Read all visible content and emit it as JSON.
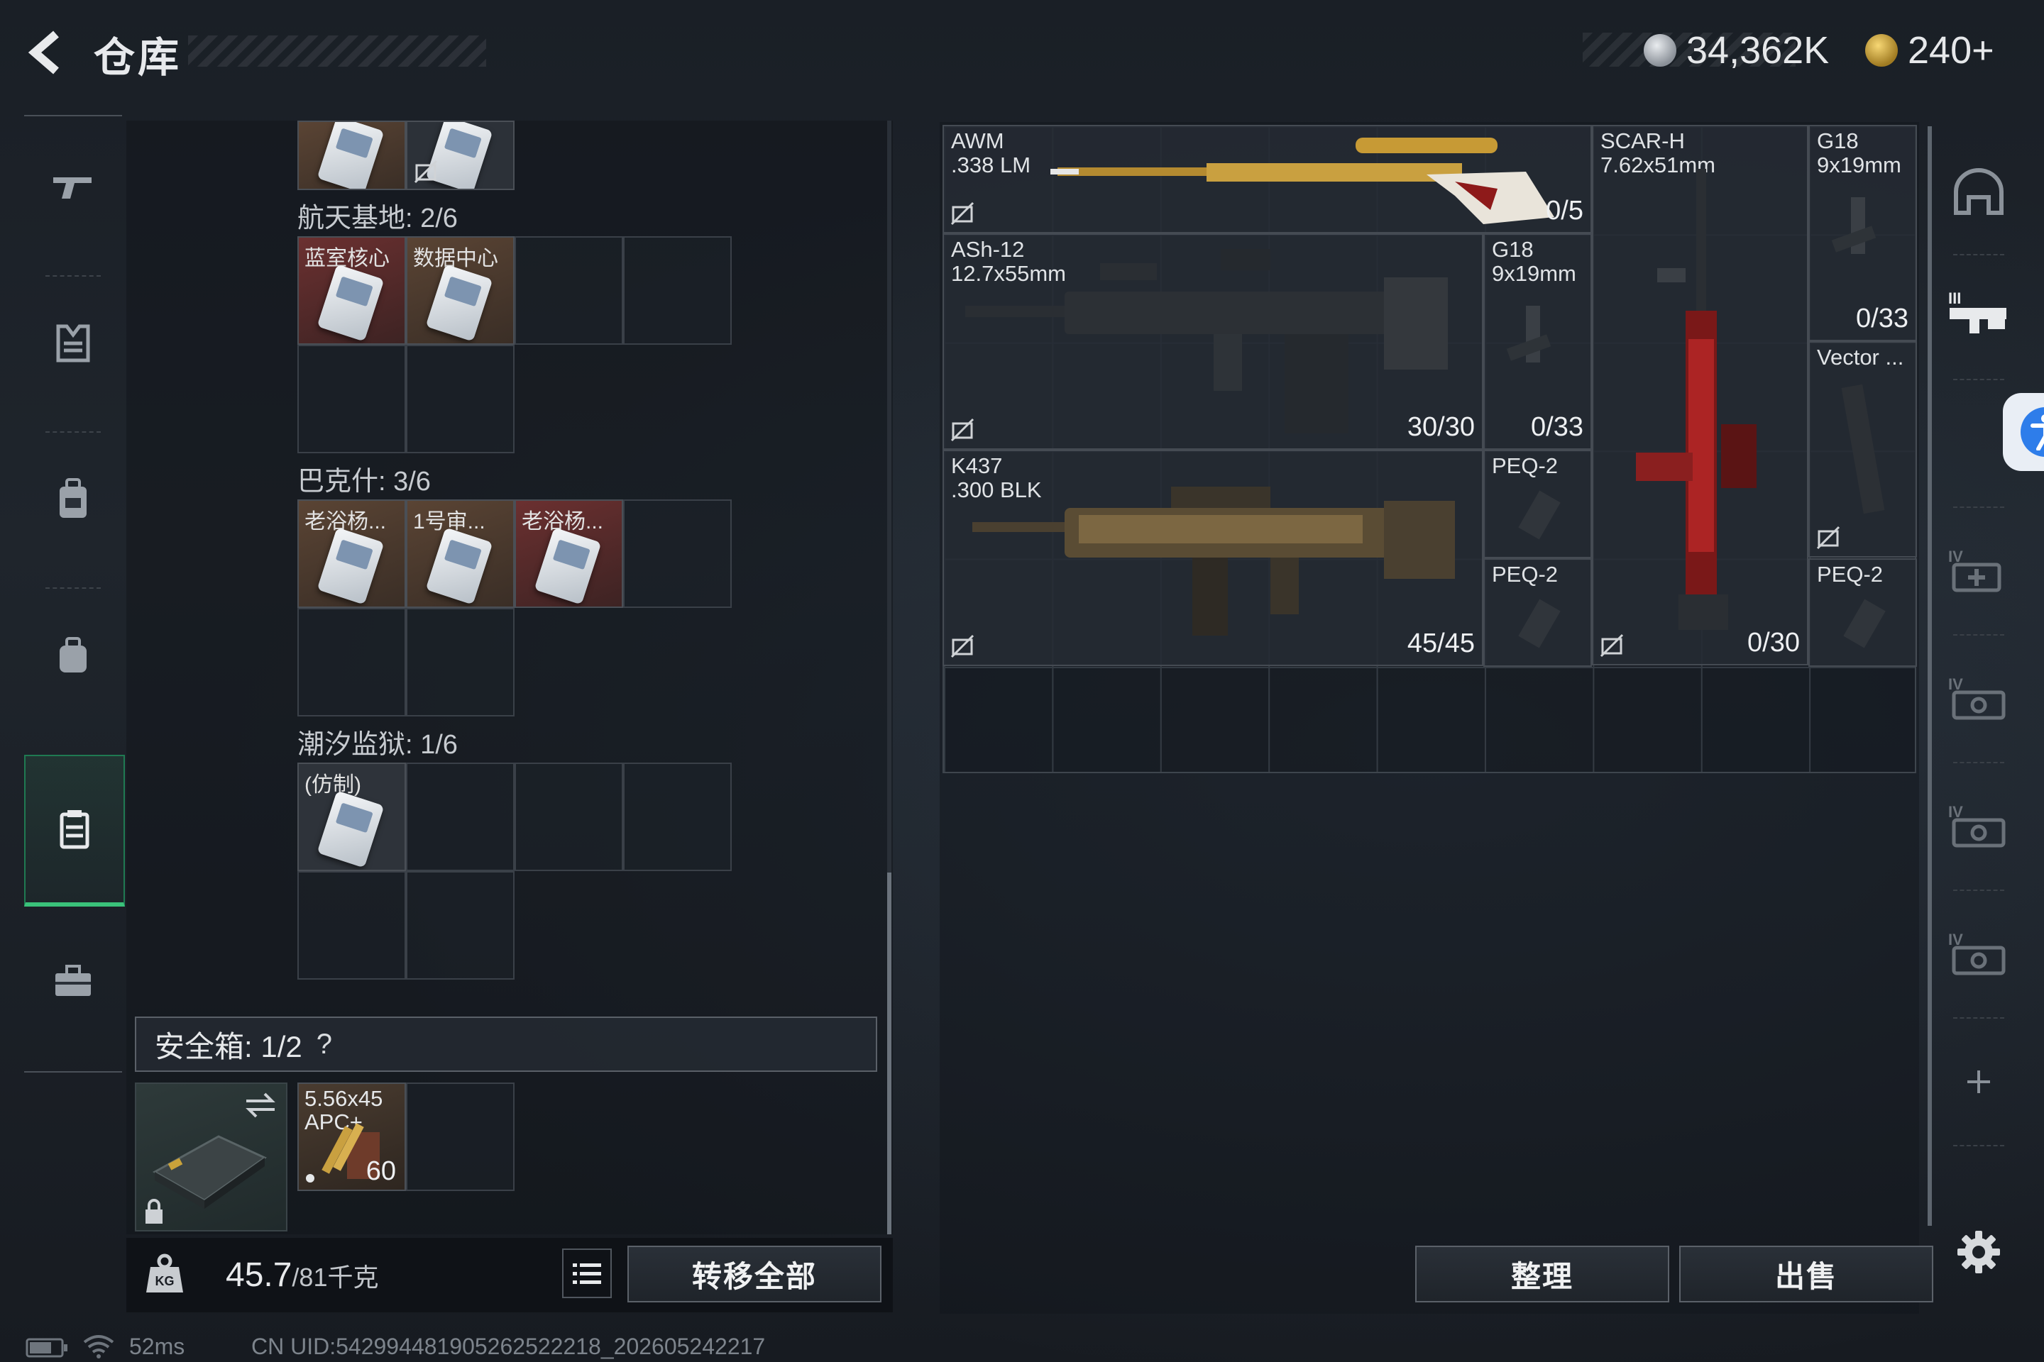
{
  "header": {
    "title": "仓库",
    "currency_silver": "34,362K",
    "currency_gold": "240+"
  },
  "left_nav": [
    "gun-icon",
    "armor-icon",
    "backpack-icon",
    "bag-icon",
    "container-icon",
    "toolbox-icon"
  ],
  "sections": [
    {
      "label": "航天基地: 2/6",
      "items": [
        "蓝室核心",
        "数据中心"
      ]
    },
    {
      "label": "巴克什: 3/6",
      "items": [
        "老浴杨...",
        "1号审...",
        "老浴杨..."
      ]
    },
    {
      "label": "潮汐监狱: 1/6",
      "items": [
        "(仿制)"
      ]
    }
  ],
  "safe_box": {
    "label": "安全箱: 1/2",
    "help": "?",
    "ammo_name": "5.56x45\nAPC+",
    "ammo_count": "60"
  },
  "weight": {
    "value": "45.7",
    "max": "/81千克"
  },
  "buttons": {
    "transfer_all": "转移全部",
    "organize": "整理",
    "sell": "出售"
  },
  "weapons": [
    {
      "name": "AWM\n.338 LM",
      "count": "0/5"
    },
    {
      "name": "SCAR-H\n7.62x51mm",
      "count": "0/30"
    },
    {
      "name": "G18\n9x19mm",
      "count": "0/33"
    },
    {
      "name": "ASh-12\n12.7x55mm",
      "count": "30/30"
    },
    {
      "name": "G18\n9x19mm",
      "count": "0/33"
    },
    {
      "name": "Vector ...",
      "count": ""
    },
    {
      "name": "K437\n.300 BLK",
      "count": "45/45"
    },
    {
      "name": "PEQ-2",
      "count": ""
    },
    {
      "name": "PEQ-2",
      "count": ""
    },
    {
      "name": "PEQ-2",
      "count": ""
    }
  ],
  "status": {
    "ping": "52ms",
    "uid": "CN UID:542994481905262522218_202605242217"
  },
  "colors": {
    "active_nav": "#3ac27a",
    "accessibility": "#2e7dea"
  }
}
